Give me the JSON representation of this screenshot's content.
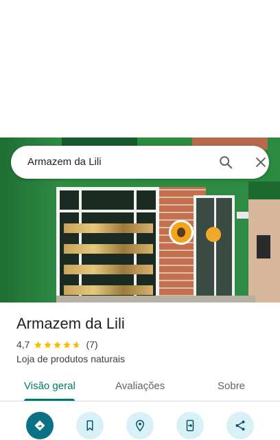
{
  "search": {
    "query": "Armazem da Lili"
  },
  "place": {
    "name": "Armazem da Lili",
    "rating": "4,7",
    "stars": 4.7,
    "review_count": "(7)",
    "category": "Loja de produtos naturais"
  },
  "tabs": [
    {
      "label": "Visão geral",
      "active": true
    },
    {
      "label": "Avaliações",
      "active": false
    },
    {
      "label": "Sobre",
      "active": false
    }
  ],
  "actions": [
    {
      "icon": "directions-icon"
    },
    {
      "icon": "bookmark-icon"
    },
    {
      "icon": "nearby-icon"
    },
    {
      "icon": "send-to-phone-icon"
    },
    {
      "icon": "share-icon"
    }
  ],
  "colors": {
    "accent": "#00796b",
    "star": "#fbbc04",
    "action_primary": "#0b7285",
    "action_secondary": "#d7f1f7"
  }
}
